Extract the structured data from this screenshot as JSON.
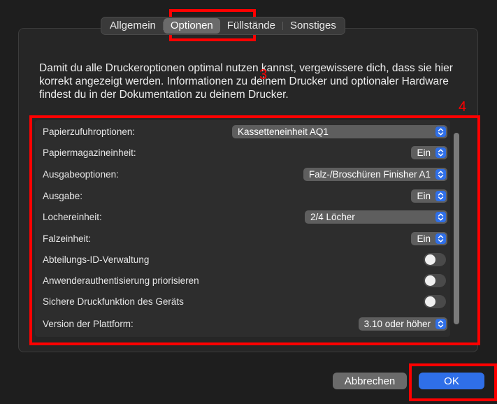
{
  "tabs": [
    {
      "label": "Allgemein"
    },
    {
      "label": "Optionen"
    },
    {
      "label": "Füllstände"
    },
    {
      "label": "Sonstiges"
    }
  ],
  "description": "Damit du alle Druckeroptionen optimal nutzen kannst, vergewissere dich, dass sie hier korrekt angezeigt werden. Informationen zu deinem Drucker und optionaler Hardware findest du in der Dokumentation zu deinem Drucker.",
  "options": [
    {
      "label": "Papierzufuhroptionen:",
      "value": "Kassetteneinheit AQ1"
    },
    {
      "label": "Papiermagazineinheit:",
      "value": "Ein"
    },
    {
      "label": "Ausgabeoptionen:",
      "value": "Falz-/Broschüren Finisher A1"
    },
    {
      "label": "Ausgabe:",
      "value": "Ein"
    },
    {
      "label": "Lochereinheit:",
      "value": "2/4 Löcher"
    },
    {
      "label": "Falzeinheit:",
      "value": "Ein"
    },
    {
      "label": "Abteilungs-ID-Verwaltung",
      "value": "off"
    },
    {
      "label": "Anwenderauthentisierung priorisieren",
      "value": "off"
    },
    {
      "label": "Sichere Druckfunktion des Geräts",
      "value": "off"
    },
    {
      "label": "Version der Plattform:",
      "value": "3.10 oder höher"
    }
  ],
  "annotations": {
    "a3": "3",
    "a4": "4"
  },
  "buttons": {
    "cancel": "Abbrechen",
    "ok": "OK"
  },
  "colors": {
    "accent": "#2f6fe8",
    "highlight": "#ff0000"
  },
  "icons": {
    "stepper": "up-down-chevron-icon"
  }
}
